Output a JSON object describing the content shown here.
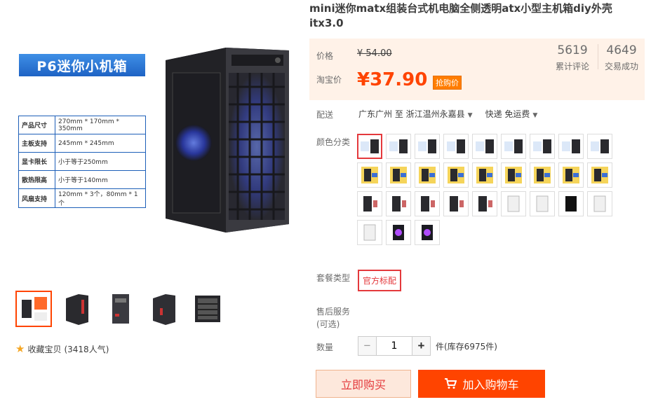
{
  "gallery": {
    "banner": "P6迷你小机箱",
    "specs": [
      {
        "k": "产品尺寸",
        "v": "270mm * 170mm * 350mm"
      },
      {
        "k": "主板支持",
        "v": "245mm * 245mm"
      },
      {
        "k": "显卡限长",
        "v": "小于等于250mm"
      },
      {
        "k": "散热限高",
        "v": "小于等于140mm"
      },
      {
        "k": "风扇支持",
        "v": "120mm * 3个，80mm * 1个"
      }
    ],
    "favorite": "收藏宝贝",
    "popularity": "(3418人气)"
  },
  "product": {
    "title": "mini迷你matx组装台式机电脑全侧透明atx小型主机箱diy外壳itx3.0"
  },
  "price": {
    "orig_label": "价格",
    "orig_price": "¥ 54.00",
    "sale_label": "淘宝价",
    "sale_price": "¥37.90",
    "tag": "抢购价",
    "reviews_count": "5619",
    "reviews_label": "累计评论",
    "sales_count": "4649",
    "sales_label": "交易成功"
  },
  "shipping": {
    "label": "配送",
    "from": "广东广州 至",
    "to": "浙江温州永嘉县",
    "method": "快递 免运费"
  },
  "color": {
    "label": "颜色分类"
  },
  "package": {
    "label": "套餐类型",
    "option": "官方标配"
  },
  "service": {
    "label": "售后服务",
    "sub": "(可选)"
  },
  "quantity": {
    "label": "数量",
    "value": "1",
    "minus": "−",
    "plus": "+",
    "stock": "件(库存6975件)"
  },
  "actions": {
    "buy": "立即购买",
    "cart": "加入购物车"
  },
  "colors": {
    "accent": "#ff4400",
    "price_bg": "#fff2e8",
    "active_border": "#e4393c"
  }
}
